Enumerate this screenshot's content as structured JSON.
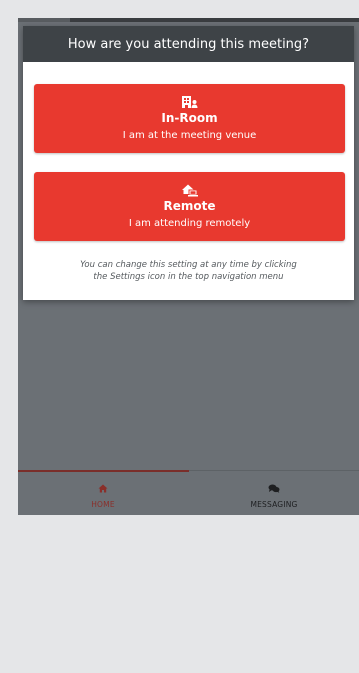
{
  "modal": {
    "title": "How are you attending this meeting?",
    "options": [
      {
        "icon": "building-user-icon",
        "title": "In-Room",
        "subtitle": "I am at the meeting venue"
      },
      {
        "icon": "house-laptop-icon",
        "title": "Remote",
        "subtitle": "I am attending remotely"
      }
    ],
    "hint_line1": "You can change this setting at any time by clicking",
    "hint_line2": "the Settings icon in the top navigation menu"
  },
  "nav": {
    "items": [
      {
        "icon": "home-icon",
        "label": "HOME",
        "active": true
      },
      {
        "icon": "chat-bubbles-icon",
        "label": "MESSAGING",
        "active": false
      }
    ]
  },
  "colors": {
    "accent": "#e8392f",
    "header": "#3e4347",
    "overlay": "#6b7075",
    "active_nav": "#8a2f2a"
  }
}
